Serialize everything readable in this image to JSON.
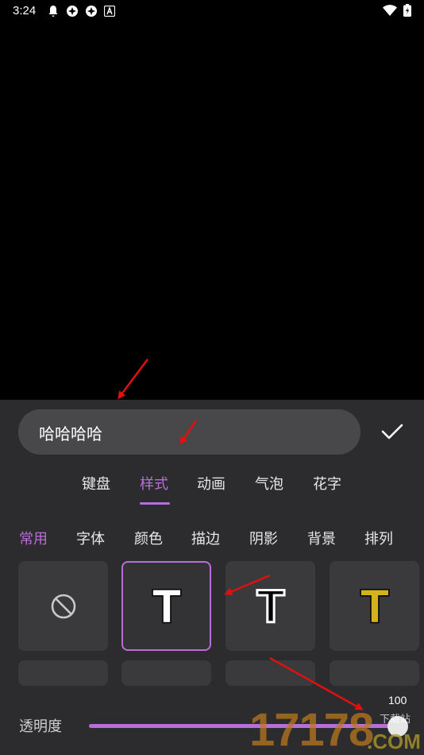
{
  "status_bar": {
    "time": "3:24",
    "icons_left": [
      "notification-bell-icon",
      "app-icon",
      "app-icon",
      "keyboard-a-icon"
    ],
    "icons_right": [
      "wifi-icon",
      "battery-charging-icon"
    ]
  },
  "editor": {
    "text_value": "哈哈哈哈",
    "confirm_icon": "checkmark-icon"
  },
  "main_tabs": [
    {
      "label": "键盘",
      "active": false
    },
    {
      "label": "样式",
      "active": true
    },
    {
      "label": "动画",
      "active": false
    },
    {
      "label": "气泡",
      "active": false
    },
    {
      "label": "花字",
      "active": false
    }
  ],
  "sub_tabs": [
    {
      "label": "常用",
      "active": true
    },
    {
      "label": "字体",
      "active": false
    },
    {
      "label": "颜色",
      "active": false
    },
    {
      "label": "描边",
      "active": false
    },
    {
      "label": "阴影",
      "active": false
    },
    {
      "label": "背景",
      "active": false
    },
    {
      "label": "排列",
      "active": false
    }
  ],
  "style_presets": [
    {
      "name": "none",
      "icon": "no-style-icon",
      "glyph": "",
      "selected": false
    },
    {
      "name": "white-outline",
      "icon": "text-style-icon",
      "glyph": "T",
      "selected": true
    },
    {
      "name": "white-black-stroke",
      "icon": "text-style-icon",
      "glyph": "T",
      "selected": false
    },
    {
      "name": "gold",
      "icon": "text-style-icon",
      "glyph": "T",
      "selected": false
    }
  ],
  "opacity": {
    "label": "透明度",
    "value": "100",
    "level": 1.0
  },
  "watermark": {
    "number": "17178",
    "sub": "下载站",
    "domain": ".COM"
  },
  "colors": {
    "accent": "#b86ed6",
    "panel": "#2c2c2e",
    "tile": "#3a3a3c",
    "annotation_arrow": "#e01010"
  }
}
